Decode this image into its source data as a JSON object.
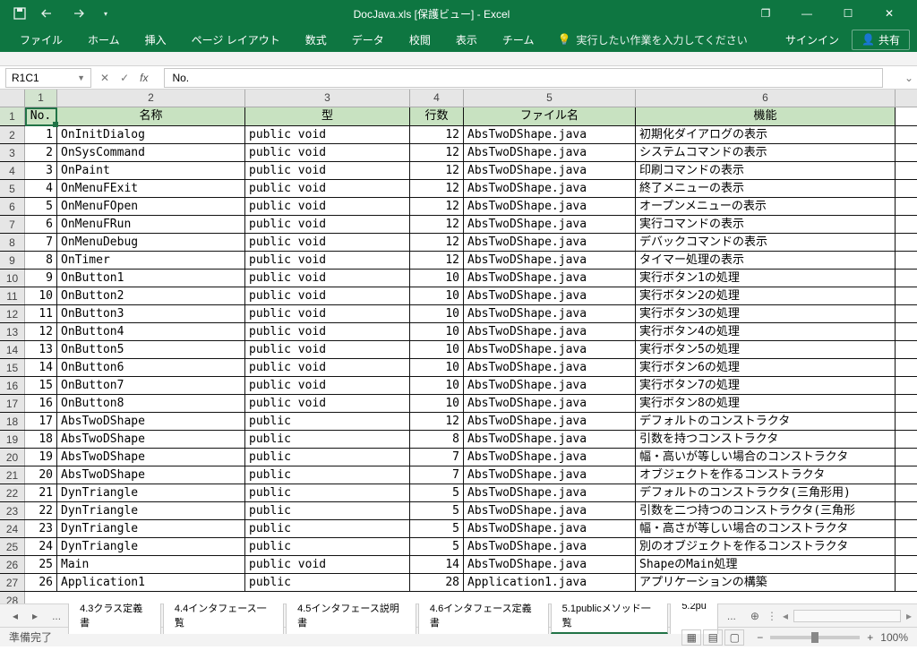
{
  "title": "DocJava.xls [保護ビュー] - Excel",
  "qat": {
    "save": "save-icon",
    "undo": "undo-icon",
    "redo": "redo-icon"
  },
  "win": {
    "restore_group": "❐",
    "min": "—",
    "max": "☐",
    "close": "✕"
  },
  "ribbon": {
    "tabs": [
      "ファイル",
      "ホーム",
      "挿入",
      "ページ レイアウト",
      "数式",
      "データ",
      "校閲",
      "表示",
      "チーム"
    ],
    "tell_me": "実行したい作業を入力してください",
    "signin": "サインイン",
    "share": "共有"
  },
  "name_box": "R1C1",
  "formula": "No.",
  "col_nums": [
    "1",
    "2",
    "3",
    "4",
    "5",
    "6"
  ],
  "headers": [
    "No.",
    "名称",
    "型",
    "行数",
    "ファイル名",
    "機能"
  ],
  "rows": [
    {
      "n": "1",
      "name": "OnInitDialog",
      "type": "public void",
      "lines": "12",
      "file": "AbsTwoDShape.java",
      "func": "初期化ダイアログの表示"
    },
    {
      "n": "2",
      "name": "OnSysCommand",
      "type": "public void",
      "lines": "12",
      "file": "AbsTwoDShape.java",
      "func": "システムコマンドの表示"
    },
    {
      "n": "3",
      "name": "OnPaint",
      "type": "public void",
      "lines": "12",
      "file": "AbsTwoDShape.java",
      "func": "印刷コマンドの表示"
    },
    {
      "n": "4",
      "name": "OnMenuFExit",
      "type": "public void",
      "lines": "12",
      "file": "AbsTwoDShape.java",
      "func": "終了メニューの表示"
    },
    {
      "n": "5",
      "name": "OnMenuFOpen",
      "type": "public void",
      "lines": "12",
      "file": "AbsTwoDShape.java",
      "func": "オープンメニューの表示"
    },
    {
      "n": "6",
      "name": "OnMenuFRun",
      "type": "public void",
      "lines": "12",
      "file": "AbsTwoDShape.java",
      "func": "実行コマンドの表示"
    },
    {
      "n": "7",
      "name": "OnMenuDebug",
      "type": "public void",
      "lines": "12",
      "file": "AbsTwoDShape.java",
      "func": "デバックコマンドの表示"
    },
    {
      "n": "8",
      "name": "OnTimer",
      "type": "public void",
      "lines": "12",
      "file": "AbsTwoDShape.java",
      "func": "タイマー処理の表示"
    },
    {
      "n": "9",
      "name": "OnButton1",
      "type": "public void",
      "lines": "10",
      "file": "AbsTwoDShape.java",
      "func": "実行ボタン1の処理"
    },
    {
      "n": "10",
      "name": "OnButton2",
      "type": "public void",
      "lines": "10",
      "file": "AbsTwoDShape.java",
      "func": "実行ボタン2の処理"
    },
    {
      "n": "11",
      "name": "OnButton3",
      "type": "public void",
      "lines": "10",
      "file": "AbsTwoDShape.java",
      "func": "実行ボタン3の処理"
    },
    {
      "n": "12",
      "name": "OnButton4",
      "type": "public void",
      "lines": "10",
      "file": "AbsTwoDShape.java",
      "func": "実行ボタン4の処理"
    },
    {
      "n": "13",
      "name": "OnButton5",
      "type": "public void",
      "lines": "10",
      "file": "AbsTwoDShape.java",
      "func": "実行ボタン5の処理"
    },
    {
      "n": "14",
      "name": "OnButton6",
      "type": "public void",
      "lines": "10",
      "file": "AbsTwoDShape.java",
      "func": "実行ボタン6の処理"
    },
    {
      "n": "15",
      "name": "OnButton7",
      "type": "public void",
      "lines": "10",
      "file": "AbsTwoDShape.java",
      "func": "実行ボタン7の処理"
    },
    {
      "n": "16",
      "name": "OnButton8",
      "type": "public void",
      "lines": "10",
      "file": "AbsTwoDShape.java",
      "func": "実行ボタン8の処理"
    },
    {
      "n": "17",
      "name": "AbsTwoDShape",
      "type": "public",
      "lines": "12",
      "file": "AbsTwoDShape.java",
      "func": "デフォルトのコンストラクタ"
    },
    {
      "n": "18",
      "name": "AbsTwoDShape",
      "type": "public",
      "lines": "8",
      "file": "AbsTwoDShape.java",
      "func": "引数を持つコンストラクタ"
    },
    {
      "n": "19",
      "name": "AbsTwoDShape",
      "type": "public",
      "lines": "7",
      "file": "AbsTwoDShape.java",
      "func": "幅・高いが等しい場合のコンストラクタ"
    },
    {
      "n": "20",
      "name": "AbsTwoDShape",
      "type": "public",
      "lines": "7",
      "file": "AbsTwoDShape.java",
      "func": "オブジェクトを作るコンストラクタ"
    },
    {
      "n": "21",
      "name": "DynTriangle",
      "type": "public",
      "lines": "5",
      "file": "AbsTwoDShape.java",
      "func": "デフォルトのコンストラクタ(三角形用)"
    },
    {
      "n": "22",
      "name": "DynTriangle",
      "type": "public",
      "lines": "5",
      "file": "AbsTwoDShape.java",
      "func": "引数を二つ持つのコンストラクタ(三角形"
    },
    {
      "n": "23",
      "name": "DynTriangle",
      "type": "public",
      "lines": "5",
      "file": "AbsTwoDShape.java",
      "func": "幅・高さが等しい場合のコンストラクタ"
    },
    {
      "n": "24",
      "name": "DynTriangle",
      "type": "public",
      "lines": "5",
      "file": "AbsTwoDShape.java",
      "func": "別のオブジェクトを作るコンストラクタ"
    },
    {
      "n": "25",
      "name": "Main",
      "type": "public void",
      "lines": "14",
      "file": "AbsTwoDShape.java",
      "func": "ShapeのMain処理"
    },
    {
      "n": "26",
      "name": "Application1",
      "type": "public",
      "lines": "28",
      "file": "Application1.java",
      "func": "アプリケーションの構築"
    }
  ],
  "sheet_tabs": {
    "prefix": "...",
    "list": [
      "4.3クラス定義書",
      "4.4インタフェース一覧",
      "4.5インタフェース説明書",
      "4.6インタフェース定義書",
      "5.1publicメソッド一覧",
      "5.2pu"
    ],
    "active_index": 4,
    "more": "..."
  },
  "status": {
    "ready": "準備完了",
    "zoom": "100%"
  }
}
